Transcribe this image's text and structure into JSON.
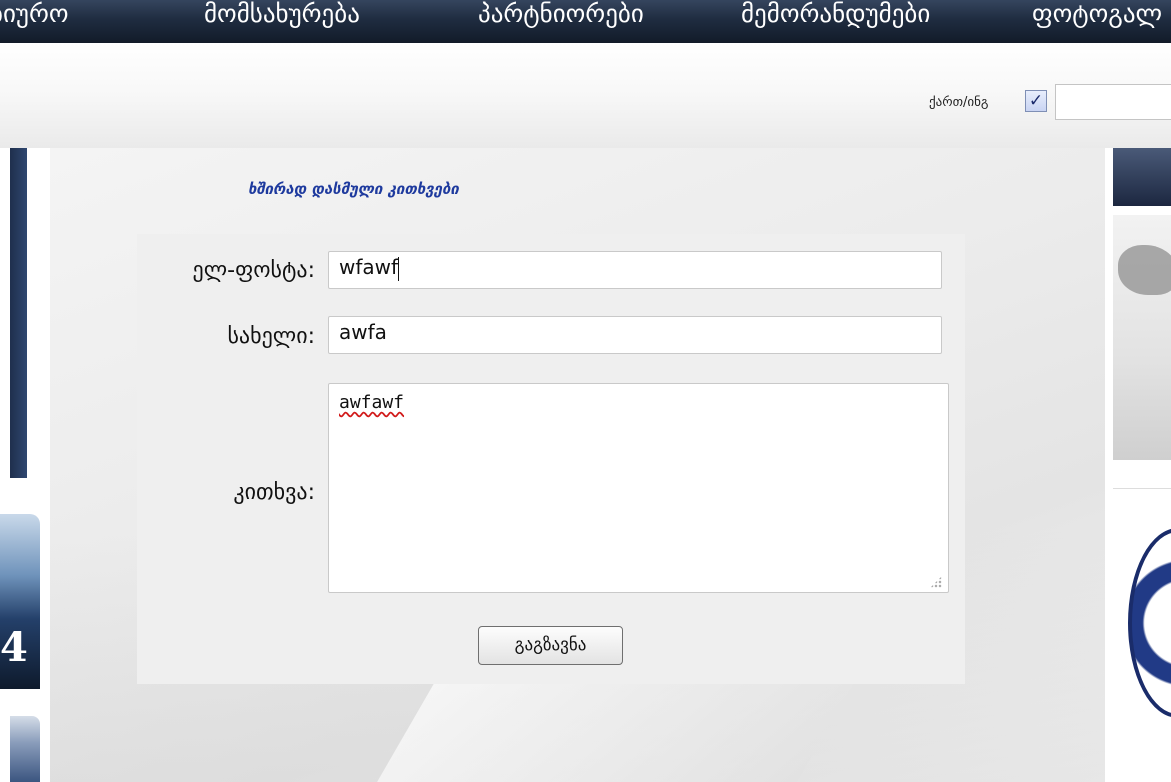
{
  "nav": {
    "items": [
      {
        "label": "ბიურო"
      },
      {
        "label": "მომსახურება"
      },
      {
        "label": "პარტნიორები"
      },
      {
        "label": "მემორანდუმები"
      },
      {
        "label": "ფოტოგალ"
      }
    ]
  },
  "header": {
    "lang_label": "ქართ/ინგ",
    "lang_checked": true
  },
  "sidebar_left": {
    "thumb_text": "4"
  },
  "main": {
    "faq_link": "ხშირად დასმული კითხვები"
  },
  "form": {
    "email_label": "ელ-ფოსტა:",
    "email_value": "wfawf",
    "name_label": "სახელი:",
    "name_value": "awfa",
    "question_label": "კითხვა:",
    "question_value": "awfawf",
    "submit_label": "გაგზავნა"
  },
  "colors": {
    "nav_bg": "#1f2c40",
    "link": "#1e3a9e",
    "panel_bg": "#efefef"
  }
}
